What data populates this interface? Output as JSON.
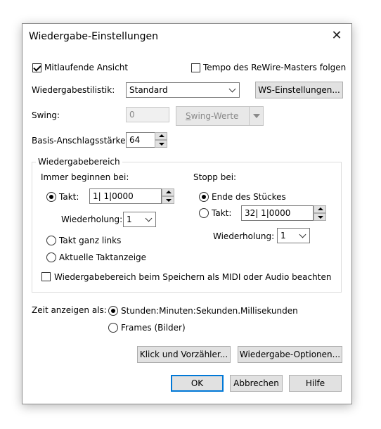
{
  "dialog": {
    "title": "Wiedergabe-Einstellungen",
    "close_glyph": "✕"
  },
  "follow_view": {
    "label": "Mitlaufende Ansicht",
    "checked": true
  },
  "rewire_tempo": {
    "label": "Tempo des ReWire-Masters folgen",
    "checked": false
  },
  "playback_style": {
    "label": "Wiedergabestilistik:",
    "selected": "Standard"
  },
  "ws_settings_button": "WS-Einstellungen...",
  "swing": {
    "label": "Swing:",
    "value": "0",
    "button_first": "S",
    "button_rest": "wing-Werte"
  },
  "velocity": {
    "label": "Basis-Anschlagsstärke:",
    "value": "64"
  },
  "playback_range": {
    "title": "Wiedergabebereich",
    "start_label": "Immer beginnen bei:",
    "takt_label": "Takt:",
    "takt_value": "1| 1|0000",
    "repeat_label": "Wiederholung:",
    "repeat_value": "1",
    "leftmost_label": "Takt ganz links",
    "current_label": "Aktuelle Taktanzeige",
    "stop_label": "Stopp bei:",
    "end_label": "Ende des Stückes",
    "stop_takt_label": "Takt:",
    "stop_takt_value": "32| 1|0000",
    "stop_repeat_label": "Wiederholung:",
    "stop_repeat_value": "1",
    "save_label": "Wiedergabebereich beim Speichern als MIDI oder Audio beachten"
  },
  "time_display": {
    "label": "Zeit anzeigen als:",
    "option_hms": "Stunden:Minuten:Sekunden.Millisekunden",
    "option_frames": "Frames (Bilder)"
  },
  "buttons": {
    "click": "Klick und Vorzähler...",
    "options": "Wiedergabe-Optionen...",
    "ok": "OK",
    "cancel": "Abbrechen",
    "help": "Hilfe"
  }
}
